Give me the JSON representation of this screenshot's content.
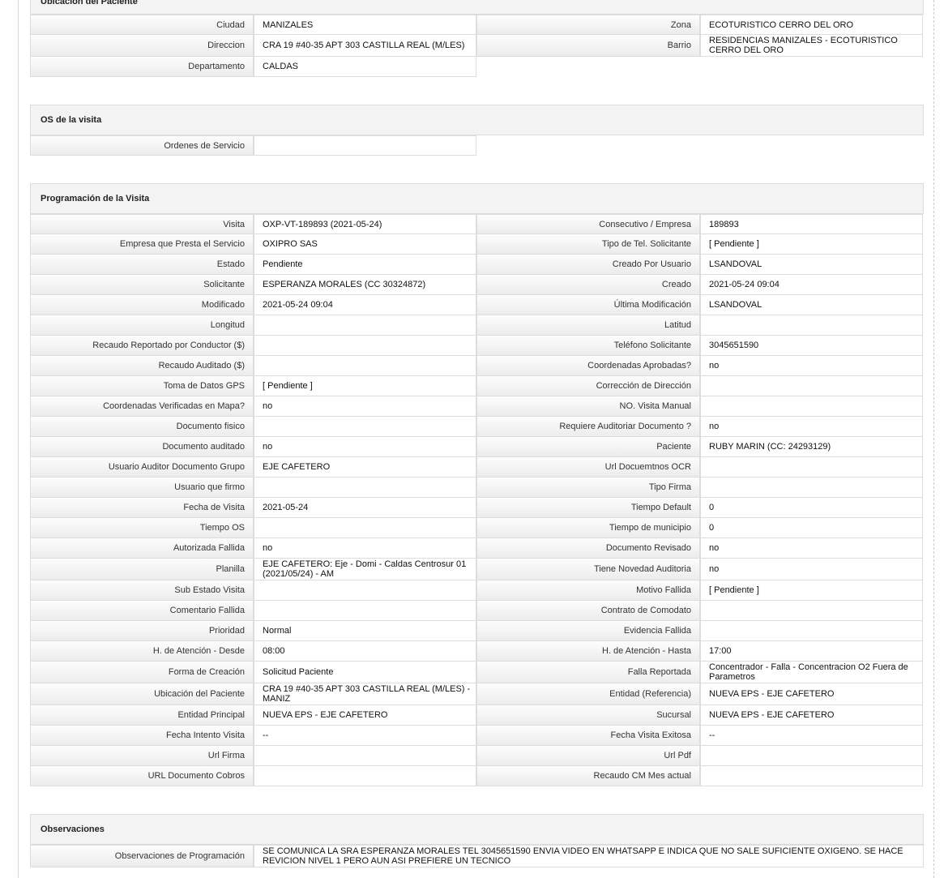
{
  "ubicacion": {
    "title": "Ubicación del Paciente",
    "rows": [
      [
        "Ciudad",
        "MANIZALES",
        "Zona",
        "ECOTURISTICO CERRO DEL ORO"
      ],
      [
        "Direccion",
        "CRA 19 #40-35 APT 303 CASTILLA REAL (M/LES)",
        "Barrio",
        "RESIDENCIAS MANIZALES - ECOTURISTICO CERRO DEL ORO"
      ],
      [
        "Departamento",
        "CALDAS"
      ]
    ]
  },
  "os_visita": {
    "title": "OS de la visita",
    "rows": [
      [
        "Ordenes de Servicio",
        ""
      ]
    ]
  },
  "programacion": {
    "title": "Programación de la Visita",
    "rows": [
      [
        "Visita",
        "OXP-VT-189893 (2021-05-24)",
        "Consecutivo / Empresa",
        "189893"
      ],
      [
        "Empresa que Presta el Servicio",
        "OXIPRO SAS",
        "Tipo de Tel. Solicitante",
        "[ Pendiente ]"
      ],
      [
        "Estado",
        "Pendiente",
        "Creado Por Usuario",
        "LSANDOVAL"
      ],
      [
        "Solicitante",
        "ESPERANZA MORALES (CC 30324872)",
        "Creado",
        "2021-05-24 09:04"
      ],
      [
        "Modificado",
        "2021-05-24 09:04",
        "Última Modificación",
        "LSANDOVAL"
      ],
      [
        "Longitud",
        "",
        "Latitud",
        ""
      ],
      [
        "Recaudo Reportado por Conductor ($)",
        "",
        "Teléfono Solicitante",
        "3045651590"
      ],
      [
        "Recaudo Auditado ($)",
        "",
        "Coordenadas Aprobadas?",
        "no"
      ],
      [
        "Toma de Datos GPS",
        "[ Pendiente ]",
        "Corrección de Dirección",
        ""
      ],
      [
        "Coordenadas Verificadas en Mapa?",
        "no",
        "NO. Visita Manual",
        ""
      ],
      [
        "Documento fisico",
        "",
        "Requiere Auditoriar Documento ?",
        "no"
      ],
      [
        "Documento auditado",
        "no",
        "Paciente",
        "RUBY MARIN (CC: 24293129)"
      ],
      [
        "Usuario Auditor Documento Grupo",
        "EJE CAFETERO",
        "Url Docuemtnos OCR",
        ""
      ],
      [
        "Usuario que firmo",
        "",
        "Tipo Firma",
        ""
      ],
      [
        "Fecha de Visita",
        "2021-05-24",
        "Tiempo Default",
        "0"
      ],
      [
        "Tiempo OS",
        "",
        "Tiempo de municipio",
        "0"
      ],
      [
        "Autorizada Fallida",
        "no",
        "Documento Revisado",
        "no"
      ],
      [
        "Planilla",
        "EJE CAFETERO: Eje - Domi - Caldas Centrosur 01 (2021/05/24) - AM",
        "Tiene Novedad Auditoria",
        "no"
      ],
      [
        "Sub Estado Visita",
        "",
        "Motivo Fallida",
        "[ Pendiente ]"
      ],
      [
        "Comentario Fallida",
        "",
        "Contrato de Comodato",
        ""
      ],
      [
        "Prioridad",
        "Normal",
        "Evidencia Fallida",
        ""
      ],
      [
        "H. de Atención - Desde",
        "08:00",
        "H. de Atención - Hasta",
        "17:00"
      ],
      [
        "Forma de Creación",
        "Solicitud Paciente",
        "Falla Reportada",
        "Concentrador - Falla - Concentracion O2 Fuera de Parametros"
      ],
      [
        "Ubicación del Paciente",
        "CRA 19 #40-35 APT 303 CASTILLA REAL (M/LES) - MANIZ",
        "Entidad (Referencia)",
        "NUEVA EPS - EJE CAFETERO"
      ],
      [
        "Entidad Principal",
        "NUEVA EPS - EJE CAFETERO",
        "Sucursal",
        "NUEVA EPS - EJE CAFETERO"
      ],
      [
        "Fecha Intento Visita",
        "--",
        "Fecha Visita Exitosa",
        "--"
      ],
      [
        "Url Firma",
        "",
        "Url Pdf",
        ""
      ],
      [
        "URL Documento Cobros",
        "",
        "Recaudo CM Mes actual",
        ""
      ]
    ]
  },
  "observaciones": {
    "title": "Observaciones",
    "rows": [
      [
        "Observaciones de Programación",
        "SE COMUNICA LA SRA ESPERANZA MORALES TEL 3045651590 ENVIA VIDEO EN WHATSAPP E INDICA QUE NO SALE SUFICIENTE OXIGENO. SE HACE REVICION NIVEL 1 PERO AUN ASI PREFIERE UN TECNICO"
      ]
    ]
  }
}
